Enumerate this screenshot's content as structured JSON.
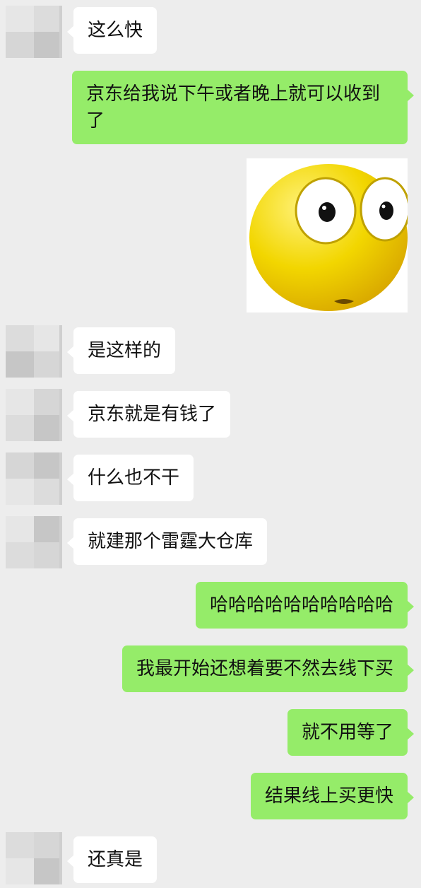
{
  "messages": [
    {
      "id": "m1",
      "side": "in",
      "text": "这么快"
    },
    {
      "id": "m2",
      "side": "out",
      "text": "京东给我说下午或者晚上就可以收到了"
    },
    {
      "id": "m3",
      "side": "out",
      "sticker": "surprised-face-emoji"
    },
    {
      "id": "m4",
      "side": "in",
      "text": "是这样的"
    },
    {
      "id": "m5",
      "side": "in",
      "text": "京东就是有钱了"
    },
    {
      "id": "m6",
      "side": "in",
      "text": "什么也不干"
    },
    {
      "id": "m7",
      "side": "in",
      "text": "就建那个雷霆大仓库"
    },
    {
      "id": "m8",
      "side": "out",
      "text": "哈哈哈哈哈哈哈哈哈哈"
    },
    {
      "id": "m9",
      "side": "out",
      "text": "我最开始还想着要不然去线下买"
    },
    {
      "id": "m10",
      "side": "out",
      "text": "就不用等了"
    },
    {
      "id": "m11",
      "side": "out",
      "text": "结果线上买更快"
    },
    {
      "id": "m12",
      "side": "in",
      "text": "还真是"
    }
  ],
  "colors": {
    "background": "#ededed",
    "incoming_bubble": "#ffffff",
    "outgoing_bubble": "#95ec69",
    "sticker_face": "#f2d600"
  }
}
